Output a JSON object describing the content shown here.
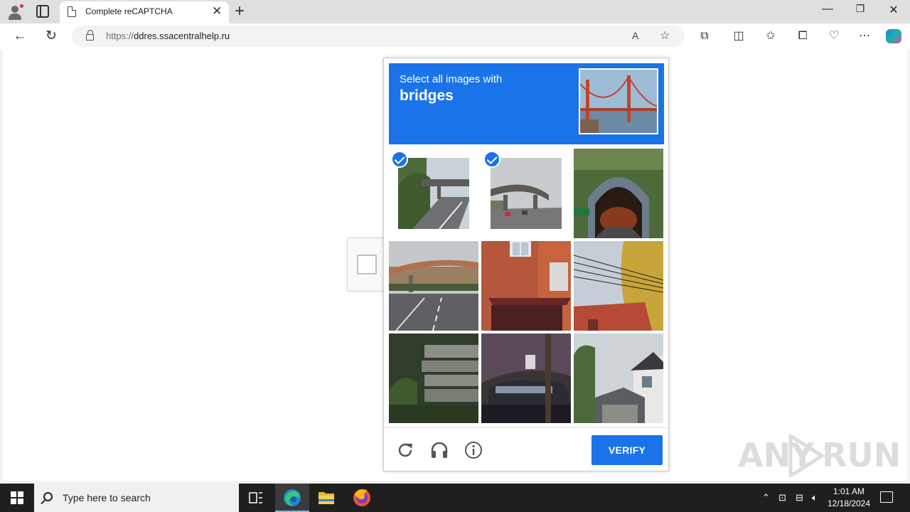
{
  "browser": {
    "tab_title": "Complete reCAPTCHA",
    "url_scheme": "https://",
    "url_host": "ddres.ssacentralhelp.ru",
    "window_controls": [
      "minimize",
      "restore",
      "close"
    ]
  },
  "captcha": {
    "prompt_line1": "Select all images with",
    "prompt_target": "bridges",
    "verify_label": "VERIFY",
    "tiles": [
      {
        "subject": "highway overpass",
        "selected": true
      },
      {
        "subject": "highway overpass",
        "selected": true
      },
      {
        "subject": "tunnel entrance",
        "selected": false
      },
      {
        "subject": "highway bridge",
        "selected": false
      },
      {
        "subject": "brick house",
        "selected": false
      },
      {
        "subject": "power lines and roof",
        "selected": false
      },
      {
        "subject": "parking structure",
        "selected": false
      },
      {
        "subject": "parked car",
        "selected": false
      },
      {
        "subject": "houses",
        "selected": false
      }
    ],
    "accent_color": "#1a73e8"
  },
  "watermark": {
    "left": "ANY",
    "right": "RUN"
  },
  "taskbar": {
    "search_placeholder": "Type here to search",
    "time": "1:01 AM",
    "date": "12/18/2024"
  }
}
